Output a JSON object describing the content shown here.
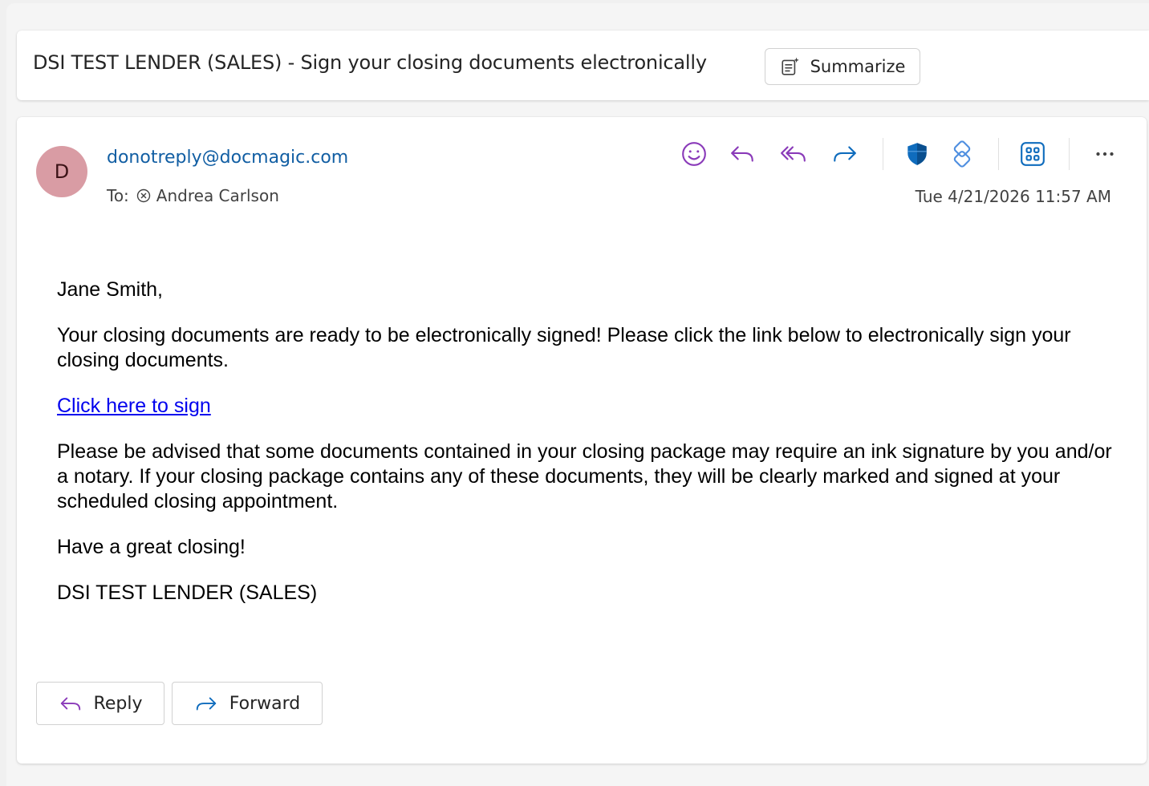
{
  "subject": {
    "title": "DSI TEST LENDER (SALES) - Sign your closing documents electronically",
    "summarize_label": "Summarize"
  },
  "message": {
    "avatar_initial": "D",
    "sender": "donotreply@docmagic.com",
    "to_label": "To:",
    "recipient": "Andrea Carlson",
    "timestamp": "Tue 4/21/2026 11:57 AM"
  },
  "toolbar": {
    "icons": [
      "emoji-icon",
      "reply-icon",
      "reply-all-icon",
      "forward-icon",
      "shield-icon",
      "immersive-reader-icon",
      "apps-icon",
      "more-icon"
    ],
    "more_label": "···"
  },
  "body": {
    "greeting": "Jane Smith,",
    "para1": "Your closing documents are ready to be electronically signed! Please click the link below to electronically sign your closing documents.",
    "link_text": "Click here to sign",
    "para2": "Please be advised that some documents contained in your closing package may require an ink signature by you and/or a notary. If your closing package contains any of these documents, they will be clearly marked and signed at your scheduled closing appointment.",
    "closing": "Have a great closing!",
    "signature": "DSI TEST LENDER (SALES)"
  },
  "actions": {
    "reply_label": "Reply",
    "forward_label": "Forward"
  },
  "colors": {
    "accent": "#115ea3",
    "toolbar_purple": "#8a3ab9",
    "shield_blue": "#0f6cbd",
    "avatar_bg": "#d99ca4",
    "link": "#0000ee"
  }
}
